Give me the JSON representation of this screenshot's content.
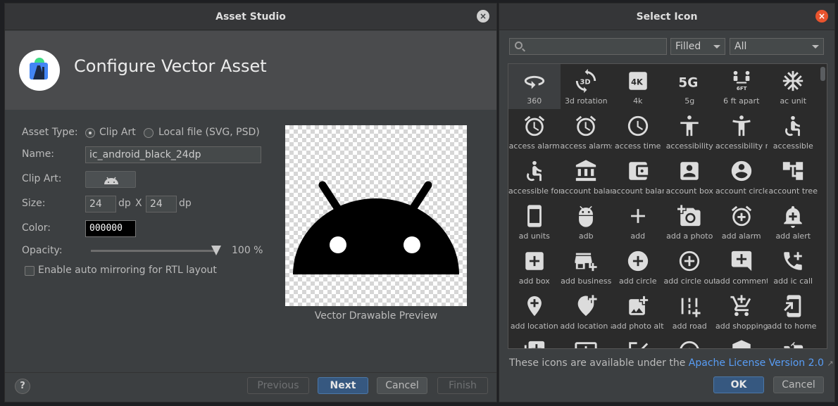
{
  "asset_studio": {
    "title": "Asset Studio",
    "close_label": "×",
    "header_title": "Configure Vector Asset",
    "asset_type_label": "Asset Type:",
    "radio_clip_art": "Clip Art",
    "radio_local_file": "Local file (SVG, PSD)",
    "name_label": "Name:",
    "name_value": "ic_android_black_24dp",
    "clip_art_label": "Clip Art:",
    "size_label": "Size:",
    "width_value": "24",
    "height_value": "24",
    "dp_unit": "dp",
    "by_label": "X",
    "color_label": "Color:",
    "color_value": "000000",
    "opacity_label": "Opacity:",
    "opacity_value": "100 %",
    "opacity_level": 1.0,
    "mirror_label": "Enable auto mirroring for RTL layout",
    "preview_caption": "Vector Drawable Preview",
    "help_label": "?",
    "buttons": {
      "previous": "Previous",
      "next": "Next",
      "cancel": "Cancel",
      "finish": "Finish"
    }
  },
  "select_icon": {
    "title": "Select Icon",
    "close_label": "×",
    "style_filter": "Filled",
    "category_filter": "All",
    "icons": [
      {
        "icon": "360",
        "label": "360"
      },
      {
        "icon": "3d-rotation",
        "label": "3d rotation"
      },
      {
        "icon": "4k",
        "label": "4k"
      },
      {
        "icon": "5g",
        "label": "5g"
      },
      {
        "icon": "6-ft-apart",
        "label": "6 ft apart"
      },
      {
        "icon": "ac-unit",
        "label": "ac unit"
      },
      {
        "icon": "access-alarm",
        "label": "access alarm"
      },
      {
        "icon": "access-alarms",
        "label": "access alarms"
      },
      {
        "icon": "access-time",
        "label": "access time"
      },
      {
        "icon": "accessibility",
        "label": "accessibility"
      },
      {
        "icon": "accessibility-new",
        "label": "accessibility ne"
      },
      {
        "icon": "accessible",
        "label": "accessible"
      },
      {
        "icon": "accessible-forward",
        "label": "accessible forw"
      },
      {
        "icon": "account-balance",
        "label": "account balanc"
      },
      {
        "icon": "account-balance-wallet",
        "label": "account balanc"
      },
      {
        "icon": "account-box",
        "label": "account box"
      },
      {
        "icon": "account-circle",
        "label": "account circle"
      },
      {
        "icon": "account-tree",
        "label": "account tree"
      },
      {
        "icon": "ad-units",
        "label": "ad units"
      },
      {
        "icon": "adb",
        "label": "adb"
      },
      {
        "icon": "add",
        "label": "add"
      },
      {
        "icon": "add-a-photo",
        "label": "add a photo"
      },
      {
        "icon": "add-alarm",
        "label": "add alarm"
      },
      {
        "icon": "add-alert",
        "label": "add alert"
      },
      {
        "icon": "add-box",
        "label": "add box"
      },
      {
        "icon": "add-business",
        "label": "add business"
      },
      {
        "icon": "add-circle",
        "label": "add circle"
      },
      {
        "icon": "add-circle-outline",
        "label": "add circle outl"
      },
      {
        "icon": "add-comment",
        "label": "add comment"
      },
      {
        "icon": "add-ic-call",
        "label": "add ic call"
      },
      {
        "icon": "add-location",
        "label": "add location"
      },
      {
        "icon": "add-location-alt",
        "label": "add location a"
      },
      {
        "icon": "add-photo-alternate",
        "label": "add photo alte"
      },
      {
        "icon": "add-road",
        "label": "add road"
      },
      {
        "icon": "add-shopping-cart",
        "label": "add shopping c"
      },
      {
        "icon": "add-to-home-screen",
        "label": "add to home s"
      },
      {
        "icon": "add-to-photos",
        "label": ""
      },
      {
        "icon": "add-to-queue",
        "label": ""
      },
      {
        "icon": "add-task",
        "label": ""
      },
      {
        "icon": "adjust",
        "label": ""
      },
      {
        "icon": "admin-panel",
        "label": ""
      },
      {
        "icon": "agriculture",
        "label": ""
      }
    ],
    "license_text": "These icons are available under the ",
    "license_link": "Apache License Version 2.0",
    "license_ext": "↗",
    "buttons": {
      "ok": "OK",
      "cancel": "Cancel"
    }
  }
}
